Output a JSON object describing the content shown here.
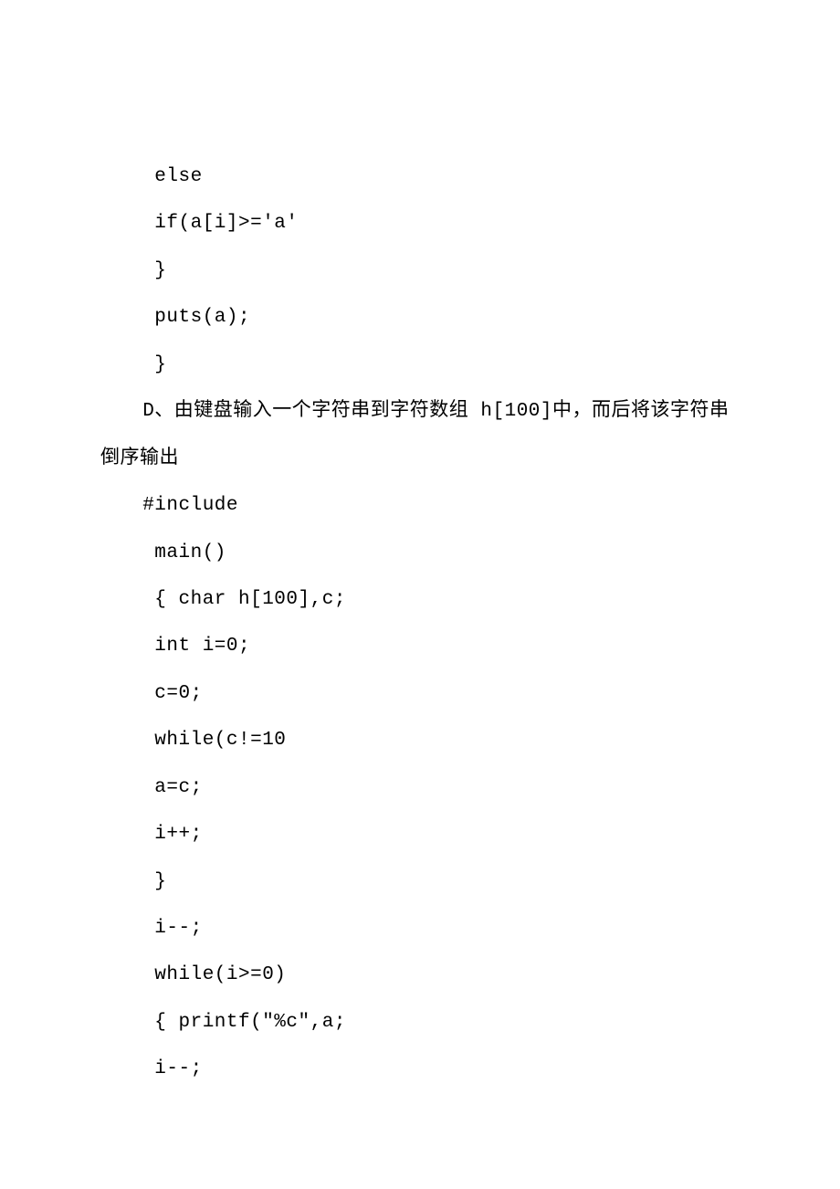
{
  "lines": {
    "l1": " else",
    "l2": " if(a[i]>='a'",
    "l3": " }",
    "l4": " puts(a);",
    "l5": " }",
    "l6": "D、由键盘输入一个字符串到字符数组 h[100]中，而后将该字符串倒序输出",
    "l7": "#include",
    "l8": " main()",
    "l9": " { char h[100],c;",
    "l10": " int i=0;",
    "l11": " c=0;",
    "l12": " while(c!=10",
    "l13": " a=c;",
    "l14": " i++;",
    "l15": " }",
    "l16": " i--;",
    "l17": " while(i>=0)",
    "l18": " { printf(\"%c\",a;",
    "l19": " i--;"
  }
}
